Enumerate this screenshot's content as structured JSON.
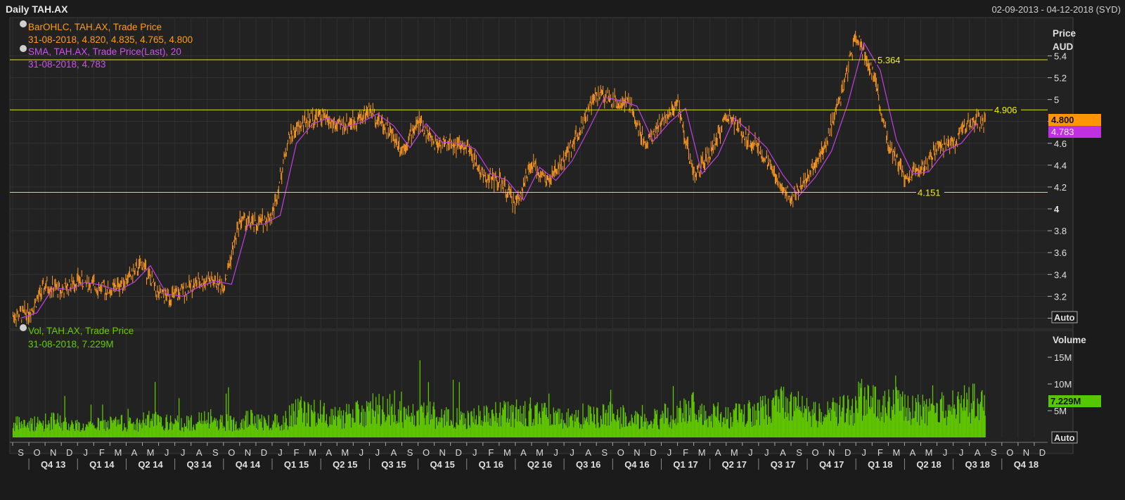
{
  "header": {
    "title": "Daily TAH.AX",
    "date_range": "02-09-2013 - 04-12-2018 (SYD)"
  },
  "price_panel": {
    "legend1_title": "BarOHLC, TAH.AX, Trade Price",
    "legend1_values": "31-08-2018, 4.820, 4.835, 4.765, 4.800",
    "legend2_title": "SMA, TAH.AX, Trade Price(Last),  20",
    "legend2_values": "31-08-2018, 4.783",
    "axis_title": "Price",
    "axis_unit": "AUD",
    "auto_label": "Auto",
    "last_price_tag": "4.800",
    "sma_tag": "4.783",
    "hlines": [
      {
        "value": 5.364,
        "label": "5.364"
      },
      {
        "value": 4.906,
        "label": "4.906"
      },
      {
        "value": 4.151,
        "label": "4.151"
      }
    ],
    "colors": {
      "ohlc": "#ff9a1f",
      "sma": "#c040e0",
      "hline": "#e6e600",
      "last_tag": "#ff9500",
      "sma_tag": "#c030e0"
    }
  },
  "volume_panel": {
    "legend_title": "Vol, TAH.AX, Trade Price",
    "legend_values": "31-08-2018, 7.229M",
    "axis_title": "Volume",
    "auto_label": "Auto",
    "last_tag": "7.229M",
    "colors": {
      "bar": "#5fc300",
      "tag": "#55c800"
    }
  },
  "xaxis": {
    "months": [
      "S",
      "O",
      "N",
      "D",
      "J",
      "F",
      "M",
      "A",
      "M",
      "J",
      "J",
      "A",
      "S",
      "O",
      "N",
      "D",
      "J",
      "F",
      "M",
      "A",
      "M",
      "J",
      "J",
      "A",
      "S",
      "O",
      "N",
      "D",
      "J",
      "F",
      "M",
      "A",
      "M",
      "J",
      "J",
      "A",
      "S",
      "O",
      "N",
      "D",
      "J",
      "F",
      "M",
      "A",
      "M",
      "J",
      "J",
      "A",
      "S",
      "O",
      "N",
      "D",
      "J",
      "F",
      "M",
      "A",
      "M",
      "J",
      "J",
      "A",
      "S",
      "O",
      "N",
      "D"
    ],
    "quarters": [
      "Q4 13",
      "Q1 14",
      "Q2 14",
      "Q3 14",
      "Q4 14",
      "Q1 15",
      "Q2 15",
      "Q3 15",
      "Q4 15",
      "Q1 16",
      "Q2 16",
      "Q3 16",
      "Q4 16",
      "Q1 17",
      "Q2 17",
      "Q3 17",
      "Q4 17",
      "Q1 18",
      "Q2 18",
      "Q3 18",
      "Q4 18"
    ]
  },
  "chart_data": [
    {
      "type": "line",
      "title": "Daily TAH.AX",
      "ylabel": "Price AUD",
      "ylim": [
        2.9,
        5.75
      ],
      "yticks": [
        "3",
        "3.2",
        "3.4",
        "3.6",
        "3.8",
        "4",
        "4.2",
        "4.4",
        "4.6",
        "4.8",
        "5",
        "5.2",
        "5.4"
      ],
      "x": [
        "2013-09",
        "2013-10",
        "2013-11",
        "2013-12",
        "2014-01",
        "2014-02",
        "2014-03",
        "2014-04",
        "2014-05",
        "2014-06",
        "2014-07",
        "2014-08",
        "2014-09",
        "2014-10",
        "2014-11",
        "2014-12",
        "2015-01",
        "2015-02",
        "2015-03",
        "2015-04",
        "2015-05",
        "2015-06",
        "2015-07",
        "2015-08",
        "2015-09",
        "2015-10",
        "2015-11",
        "2015-12",
        "2016-01",
        "2016-02",
        "2016-03",
        "2016-04",
        "2016-05",
        "2016-06",
        "2016-07",
        "2016-08",
        "2016-09",
        "2016-10",
        "2016-11",
        "2016-12",
        "2017-01",
        "2017-02",
        "2017-03",
        "2017-04",
        "2017-05",
        "2017-06",
        "2017-07",
        "2017-08",
        "2017-09",
        "2017-10",
        "2017-11",
        "2017-12",
        "2018-01",
        "2018-02",
        "2018-03",
        "2018-04",
        "2018-05",
        "2018-06",
        "2018-07",
        "2018-08"
      ],
      "series": [
        {
          "name": "BarOHLC, TAH.AX, Trade Price",
          "values": [
            3.02,
            3.05,
            3.3,
            3.25,
            3.35,
            3.3,
            3.25,
            3.35,
            3.5,
            3.2,
            3.2,
            3.3,
            3.35,
            3.3,
            3.9,
            3.85,
            3.95,
            4.65,
            4.8,
            4.85,
            4.75,
            4.8,
            4.9,
            4.75,
            4.55,
            4.8,
            4.6,
            4.6,
            4.55,
            4.3,
            4.25,
            4.05,
            4.4,
            4.25,
            4.45,
            4.75,
            5.05,
            5.0,
            4.95,
            4.6,
            4.8,
            4.95,
            4.3,
            4.5,
            4.85,
            4.7,
            4.55,
            4.3,
            4.1,
            4.3,
            4.55,
            5.0,
            5.6,
            5.25,
            4.6,
            4.3,
            4.35,
            4.55,
            4.6,
            4.8
          ]
        },
        {
          "name": "SMA, TAH.AX, Trade Price(Last),  20",
          "values": [
            3.0,
            3.05,
            3.28,
            3.26,
            3.33,
            3.3,
            3.25,
            3.33,
            3.48,
            3.22,
            3.2,
            3.29,
            3.34,
            3.31,
            3.85,
            3.86,
            3.94,
            4.6,
            4.78,
            4.83,
            4.75,
            4.79,
            4.87,
            4.76,
            4.56,
            4.78,
            4.61,
            4.6,
            4.55,
            4.32,
            4.26,
            4.08,
            4.38,
            4.26,
            4.44,
            4.72,
            5.02,
            4.99,
            4.94,
            4.62,
            4.79,
            4.92,
            4.32,
            4.49,
            4.83,
            4.7,
            4.56,
            4.31,
            4.12,
            4.29,
            4.53,
            4.96,
            5.52,
            5.27,
            4.63,
            4.32,
            4.34,
            4.53,
            4.6,
            4.783
          ]
        }
      ],
      "hlines": [
        5.364,
        4.906,
        4.151
      ]
    },
    {
      "type": "bar",
      "title": "Vol, TAH.AX, Trade Price",
      "ylabel": "Volume",
      "ylim": [
        0,
        20000000
      ],
      "yticks": [
        "5M",
        "10M",
        "15M"
      ],
      "x": [
        "2013-09",
        "2013-10",
        "2013-11",
        "2013-12",
        "2014-01",
        "2014-02",
        "2014-03",
        "2014-04",
        "2014-05",
        "2014-06",
        "2014-07",
        "2014-08",
        "2014-09",
        "2014-10",
        "2014-11",
        "2014-12",
        "2015-01",
        "2015-02",
        "2015-03",
        "2015-04",
        "2015-05",
        "2015-06",
        "2015-07",
        "2015-08",
        "2015-09",
        "2015-10",
        "2015-11",
        "2015-12",
        "2016-01",
        "2016-02",
        "2016-03",
        "2016-04",
        "2016-05",
        "2016-06",
        "2016-07",
        "2016-08",
        "2016-09",
        "2016-10",
        "2016-11",
        "2016-12",
        "2017-01",
        "2017-02",
        "2017-03",
        "2017-04",
        "2017-05",
        "2017-06",
        "2017-07",
        "2017-08",
        "2017-09",
        "2017-10",
        "2017-11",
        "2017-12",
        "2018-01",
        "2018-02",
        "2018-03",
        "2018-04",
        "2018-05",
        "2018-06",
        "2018-07",
        "2018-08"
      ],
      "values": [
        2500000,
        2600000,
        3000000,
        2500000,
        2000000,
        2400000,
        2700000,
        2500000,
        3200000,
        2700000,
        2600000,
        3100000,
        3000000,
        2800000,
        3400000,
        2900000,
        3200000,
        5000000,
        4500000,
        4300000,
        4000000,
        4500000,
        5200000,
        5500000,
        4000000,
        4500000,
        3800000,
        3600000,
        3800000,
        4500000,
        4300000,
        4800000,
        4200000,
        3800000,
        3700000,
        4000000,
        4200000,
        3900000,
        3800000,
        3600000,
        4000000,
        5500000,
        4500000,
        4200000,
        4000000,
        4600000,
        5000000,
        6000000,
        5500000,
        4200000,
        4500000,
        5000000,
        7000000,
        6500000,
        6000000,
        5200000,
        5000000,
        5600000,
        6200000,
        6500000
      ],
      "last": 7229000
    }
  ]
}
